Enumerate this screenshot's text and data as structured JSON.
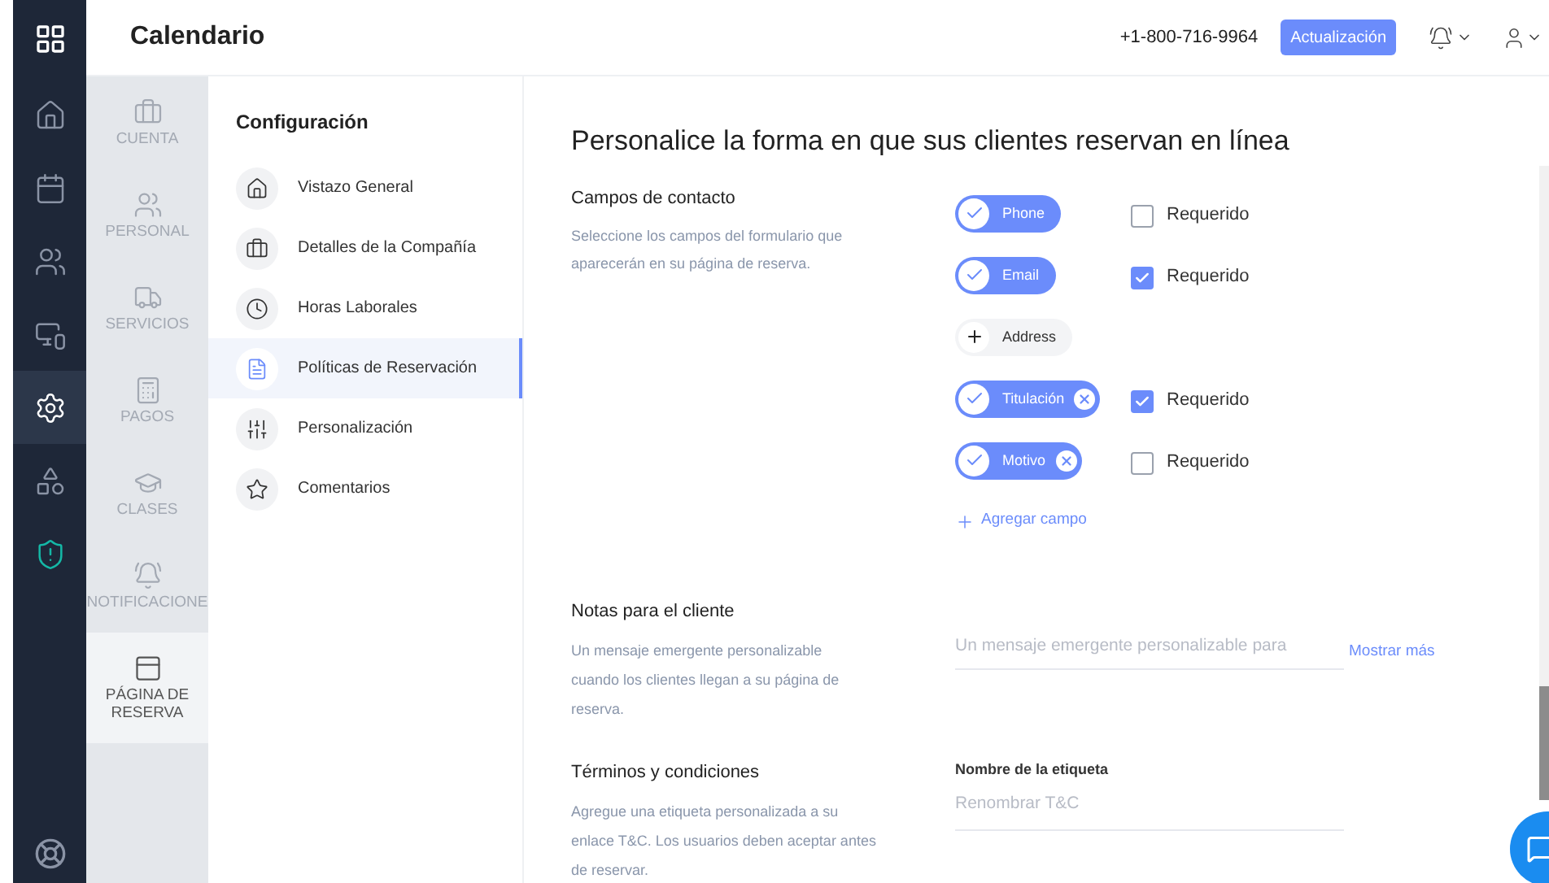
{
  "rail": {
    "items": [
      {
        "kind": "home",
        "selected": false
      },
      {
        "kind": "calendar",
        "selected": false
      },
      {
        "kind": "people",
        "selected": false
      },
      {
        "kind": "devices",
        "selected": false
      },
      {
        "kind": "gear",
        "selected": true
      },
      {
        "kind": "shapes",
        "selected": false
      },
      {
        "kind": "shield",
        "selected": false
      }
    ]
  },
  "header": {
    "title": "Calendario",
    "phone": "+1-800-716-9964",
    "upgrade_button": "Actualización"
  },
  "subnav": {
    "items": [
      {
        "label": "CUENTA",
        "kind": "briefcase",
        "selected": false
      },
      {
        "label": "PERSONAL",
        "kind": "people",
        "selected": false
      },
      {
        "label": "SERVICIOS",
        "kind": "truck",
        "selected": false
      },
      {
        "label": "PAGOS",
        "kind": "register",
        "selected": false
      },
      {
        "label": "CLASES",
        "kind": "cap",
        "selected": false
      },
      {
        "label": "NOTIFICACIONE",
        "kind": "bell",
        "selected": false
      },
      {
        "label": "PÁGINA DE RESERVA",
        "kind": "page",
        "selected": true
      }
    ]
  },
  "settings_menu": {
    "title": "Configuración",
    "items": [
      {
        "label": "Vistazo General",
        "kind": "home",
        "selected": false
      },
      {
        "label": "Detalles de la Compañía",
        "kind": "briefcase",
        "selected": false
      },
      {
        "label": "Horas Laborales",
        "kind": "clock",
        "selected": false
      },
      {
        "label": "Políticas de Reservación",
        "kind": "doc",
        "selected": true
      },
      {
        "label": "Personalización",
        "kind": "sliders",
        "selected": false
      },
      {
        "label": "Comentarios",
        "kind": "star",
        "selected": false
      }
    ]
  },
  "content": {
    "heading": "Personalice la forma en que sus clientes reservan en línea",
    "contact": {
      "title": "Campos de contacto",
      "description": "Seleccione los campos del formulario que aparecerán en su página de reserva.",
      "fields": [
        {
          "label": "Phone",
          "selected": true,
          "removable": false,
          "required": {
            "label": "Requerido",
            "checked": false
          }
        },
        {
          "label": "Email",
          "selected": true,
          "removable": false,
          "required": {
            "label": "Requerido",
            "checked": true
          }
        },
        {
          "label": "Address",
          "selected": false,
          "removable": false
        },
        {
          "label": "Titulación",
          "selected": true,
          "removable": true,
          "required": {
            "label": "Requerido",
            "checked": true
          }
        },
        {
          "label": "Motivo",
          "selected": true,
          "removable": true,
          "required": {
            "label": "Requerido",
            "checked": false
          }
        }
      ],
      "add_field": "Agregar campo"
    },
    "notes": {
      "title": "Notas para el cliente",
      "description": "Un mensaje emergente personalizable cuando los clientes llegan a su página de reserva.",
      "placeholder": "Un mensaje emergente personalizable para",
      "more_link": "Mostrar más"
    },
    "terms": {
      "title": "Términos y condiciones",
      "description": "Agregue una etiqueta personalizada a su enlace T&C. Los usuarios deben aceptar antes de reservar.",
      "field_label": "Nombre de la etiqueta",
      "placeholder": "Renombrar T&C"
    }
  }
}
